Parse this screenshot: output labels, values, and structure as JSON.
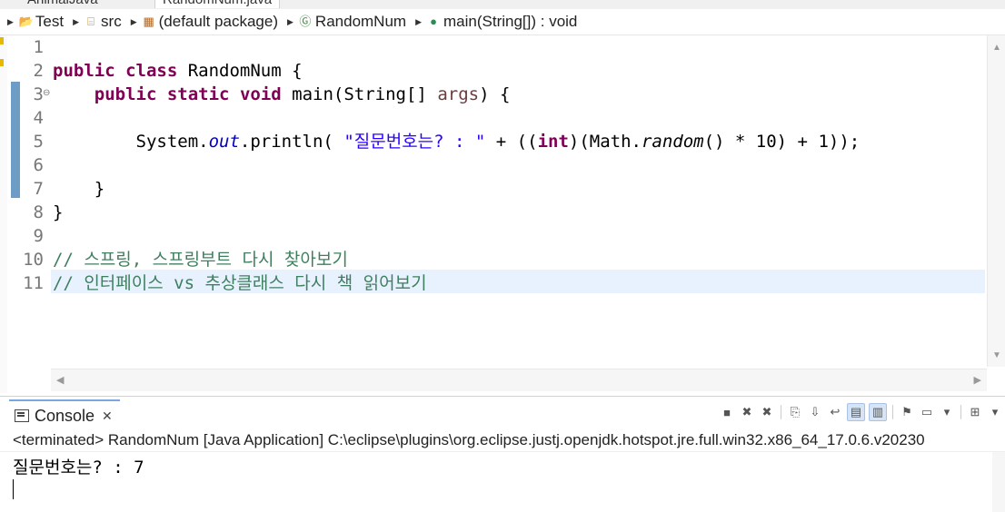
{
  "tabs": [
    "AnimalJava",
    "RandomNum.java"
  ],
  "breadcrumb": {
    "items": [
      {
        "label": "Test",
        "icon": "project-icon"
      },
      {
        "label": "src",
        "icon": "source-folder-icon"
      },
      {
        "label": "(default package)",
        "icon": "package-icon"
      },
      {
        "label": "RandomNum",
        "icon": "class-icon"
      },
      {
        "label": "main(String[]) : void",
        "icon": "method-icon"
      }
    ]
  },
  "editor": {
    "line_numbers": [
      "1",
      "2",
      "3",
      "4",
      "5",
      "6",
      "7",
      "8",
      "9",
      "10",
      "11"
    ],
    "lines": {
      "l2": {
        "kw1": "public",
        "kw2": "class",
        "rest": " RandomNum {"
      },
      "l3": {
        "kw1": "public",
        "kw2": "static",
        "kw3": "void",
        "rest1": " main(String[] ",
        "args": "args",
        "rest2": ") {"
      },
      "l5": {
        "p1": "System.",
        "out": "out",
        "p2": ".println( ",
        "str": "\"질문번호는? : \"",
        "p3": " + ((",
        "kw": "int",
        "p4": ")(Math.",
        "random": "random",
        "p5": "() * 10) + 1));"
      },
      "l7": "}",
      "l8": "}",
      "l10": "// 스프링, 스프링부트 다시 찾아보기",
      "l11": "// 인터페이스 vs 추상클래스 다시 책 읽어보기"
    }
  },
  "console": {
    "tab_label": "Console",
    "terminated": "<terminated> RandomNum [Java Application] C:\\eclipse\\plugins\\org.eclipse.justj.openjdk.hotspot.jre.full.win32.x86_64_17.0.6.v20230",
    "output": "질문번호는? : 7"
  },
  "colors": {
    "keyword": "#7f0055",
    "string": "#2a00ff",
    "field": "#0000c0",
    "comment": "#3f7f5f",
    "current_line": "#e8f2fe",
    "change_bar": "#6d9cc4"
  }
}
